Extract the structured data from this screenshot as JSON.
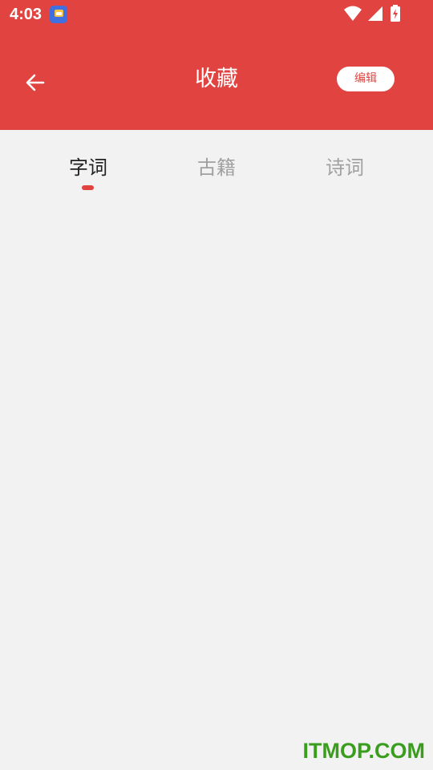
{
  "status_bar": {
    "time": "4:03",
    "app_icon": "notification-app-icon",
    "icons": [
      "wifi-icon",
      "cell-signal-icon",
      "battery-charging-icon"
    ]
  },
  "header": {
    "title": "收藏",
    "edit_label": "编辑",
    "back_icon": "arrow-left-icon",
    "background_color": "#e14440"
  },
  "tabs": [
    {
      "label": "字词",
      "active": true
    },
    {
      "label": "古籍",
      "active": false
    },
    {
      "label": "诗词",
      "active": false
    }
  ],
  "content": {
    "items": []
  },
  "watermark": "ITMOP.COM",
  "colors": {
    "accent": "#e14440",
    "page_background": "#f2f2f2",
    "tab_active": "#222222",
    "tab_inactive": "#a0a0a0",
    "watermark": "#3a9d1e"
  }
}
